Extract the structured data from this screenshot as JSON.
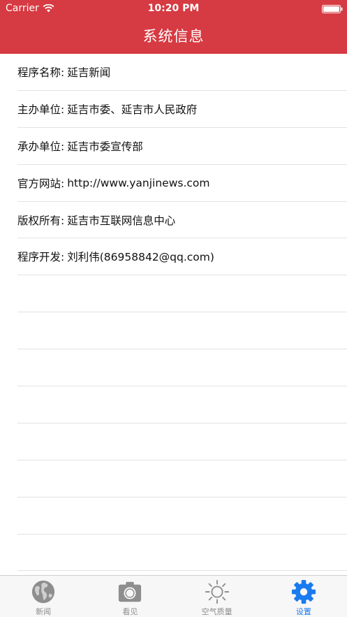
{
  "status_bar": {
    "carrier": "Carrier",
    "time": "10:20 PM"
  },
  "nav": {
    "title": "系统信息"
  },
  "info_rows": [
    {
      "label": "程序名称:",
      "value": "延吉新闻"
    },
    {
      "label": "主办单位:",
      "value": "延吉市委、延吉市人民政府"
    },
    {
      "label": "承办单位:",
      "value": "延吉市委宣传部"
    },
    {
      "label": "官方网站:",
      "value": "http://www.yanjinews.com"
    },
    {
      "label": "版权所有:",
      "value": "延吉市互联网信息中心"
    },
    {
      "label": "程序开发:",
      "value": "刘利伟(86958842@qq.com)"
    }
  ],
  "tabs": [
    {
      "label": "新闻",
      "icon": "globe-icon"
    },
    {
      "label": "看见",
      "icon": "camera-icon"
    },
    {
      "label": "空气质量",
      "icon": "sun-icon"
    },
    {
      "label": "设置",
      "icon": "gear-icon"
    }
  ],
  "colors": {
    "header": "#d63a42",
    "tab_active": "#1a7bf0",
    "tab_inactive": "#8e8e8e"
  }
}
